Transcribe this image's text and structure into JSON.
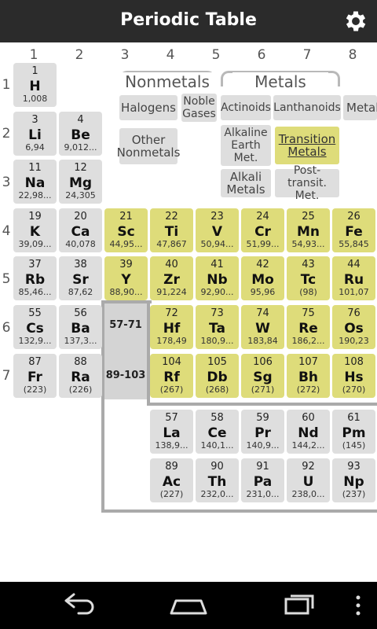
{
  "app": {
    "title": "Periodic Table",
    "settings_icon": "gear-icon"
  },
  "columns": [
    "1",
    "2",
    "3",
    "4",
    "5",
    "6",
    "7",
    "8"
  ],
  "rows": [
    "1",
    "2",
    "3",
    "4",
    "5",
    "6",
    "7"
  ],
  "categories": {
    "nonmetals": "Nonmetals",
    "metals": "Metals",
    "halogens": "Halogens",
    "noble_gases": "Noble Gases",
    "actinoids": "Actinoids",
    "lanthanoids": "Lanthanoids",
    "metalloids": "Metall",
    "other_nonmetals": "Other Nonmetals",
    "alkaline_earth": "Alkaline Earth Met.",
    "transition": "Transition Metals",
    "alkali": "Alkali Metals",
    "post_transition": "Post-transit. Met."
  },
  "colors": {
    "transition": "#dedc7a",
    "default": "#dedede",
    "appbar": "#2b2b2b"
  },
  "refs": {
    "lanthanides": "57-71",
    "actinides": "89-103"
  },
  "elements": [
    {
      "n": "1",
      "s": "H",
      "m": "1,008"
    },
    {
      "n": "3",
      "s": "Li",
      "m": "6,94"
    },
    {
      "n": "4",
      "s": "Be",
      "m": "9,012..."
    },
    {
      "n": "11",
      "s": "Na",
      "m": "22,98..."
    },
    {
      "n": "12",
      "s": "Mg",
      "m": "24,305"
    },
    {
      "n": "19",
      "s": "K",
      "m": "39,09..."
    },
    {
      "n": "20",
      "s": "Ca",
      "m": "40,078"
    },
    {
      "n": "21",
      "s": "Sc",
      "m": "44,95..."
    },
    {
      "n": "22",
      "s": "Ti",
      "m": "47,867"
    },
    {
      "n": "23",
      "s": "V",
      "m": "50,94..."
    },
    {
      "n": "24",
      "s": "Cr",
      "m": "51,99..."
    },
    {
      "n": "25",
      "s": "Mn",
      "m": "54,93..."
    },
    {
      "n": "26",
      "s": "Fe",
      "m": "55,845"
    },
    {
      "n": "37",
      "s": "Rb",
      "m": "85,46..."
    },
    {
      "n": "38",
      "s": "Sr",
      "m": "87,62"
    },
    {
      "n": "39",
      "s": "Y",
      "m": "88,90..."
    },
    {
      "n": "40",
      "s": "Zr",
      "m": "91,224"
    },
    {
      "n": "41",
      "s": "Nb",
      "m": "92,90..."
    },
    {
      "n": "42",
      "s": "Mo",
      "m": "95,96"
    },
    {
      "n": "43",
      "s": "Tc",
      "m": "(98)"
    },
    {
      "n": "44",
      "s": "Ru",
      "m": "101,07"
    },
    {
      "n": "55",
      "s": "Cs",
      "m": "132,9..."
    },
    {
      "n": "56",
      "s": "Ba",
      "m": "137,3..."
    },
    {
      "n": "72",
      "s": "Hf",
      "m": "178,49"
    },
    {
      "n": "73",
      "s": "Ta",
      "m": "180,9..."
    },
    {
      "n": "74",
      "s": "W",
      "m": "183,84"
    },
    {
      "n": "75",
      "s": "Re",
      "m": "186,2..."
    },
    {
      "n": "76",
      "s": "Os",
      "m": "190,23"
    },
    {
      "n": "87",
      "s": "Fr",
      "m": "(223)"
    },
    {
      "n": "88",
      "s": "Ra",
      "m": "(226)"
    },
    {
      "n": "104",
      "s": "Rf",
      "m": "(267)"
    },
    {
      "n": "105",
      "s": "Db",
      "m": "(268)"
    },
    {
      "n": "106",
      "s": "Sg",
      "m": "(271)"
    },
    {
      "n": "107",
      "s": "Bh",
      "m": "(272)"
    },
    {
      "n": "108",
      "s": "Hs",
      "m": "(270)"
    },
    {
      "n": "57",
      "s": "La",
      "m": "138,9..."
    },
    {
      "n": "58",
      "s": "Ce",
      "m": "140,1..."
    },
    {
      "n": "59",
      "s": "Pr",
      "m": "140,9..."
    },
    {
      "n": "60",
      "s": "Nd",
      "m": "144,2..."
    },
    {
      "n": "61",
      "s": "Pm",
      "m": "(145)"
    },
    {
      "n": "89",
      "s": "Ac",
      "m": "(227)"
    },
    {
      "n": "90",
      "s": "Th",
      "m": "232,0..."
    },
    {
      "n": "91",
      "s": "Pa",
      "m": "231,0..."
    },
    {
      "n": "92",
      "s": "U",
      "m": "238,0..."
    },
    {
      "n": "93",
      "s": "Np",
      "m": "(237)"
    }
  ],
  "navbar": {
    "back": "back-icon",
    "home": "home-icon",
    "recents": "recents-icon",
    "menu": "overflow-menu-icon"
  }
}
